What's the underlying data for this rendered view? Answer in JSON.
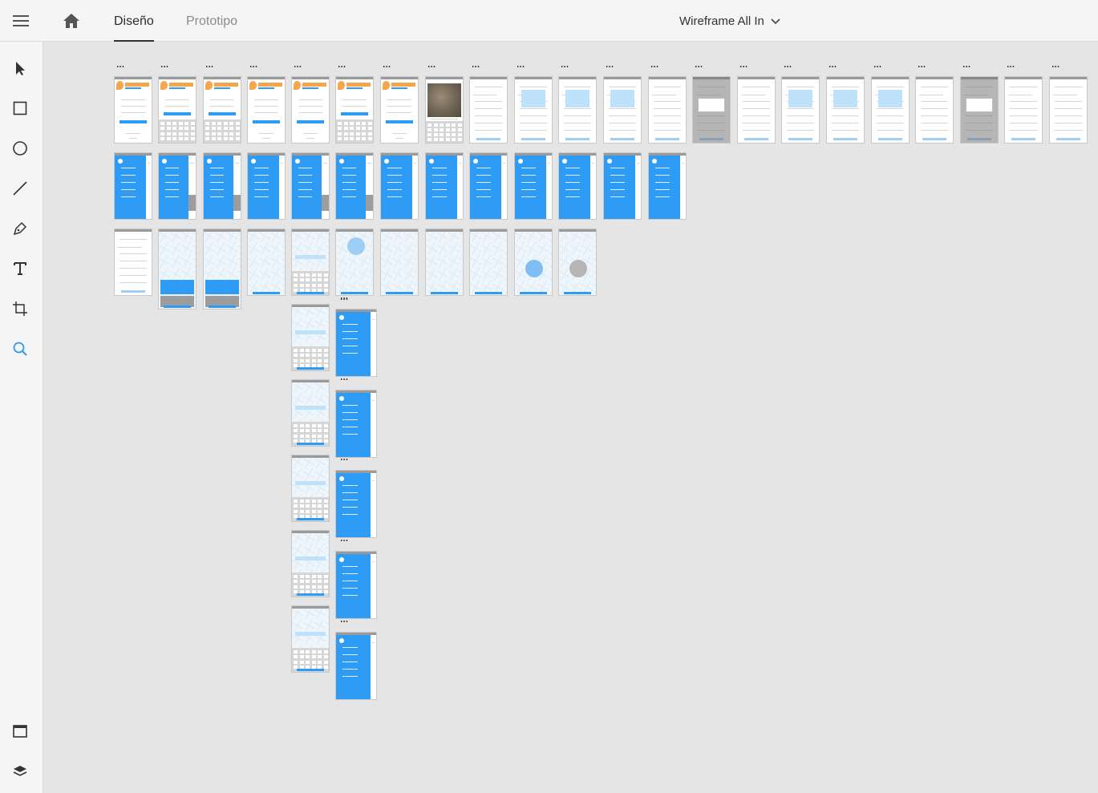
{
  "header": {
    "menu_icon": "hamburger-menu-icon",
    "home_icon": "home-icon",
    "tabs": [
      {
        "label": "Diseño",
        "active": true
      },
      {
        "label": "Prototipo",
        "active": false
      }
    ],
    "document_title": "Wireframe All In",
    "dropdown_icon": "chevron-down-icon"
  },
  "toolbar": {
    "tools": [
      {
        "name": "select-tool",
        "icon": "arrow-cursor-icon"
      },
      {
        "name": "rectangle-tool",
        "icon": "rectangle-icon"
      },
      {
        "name": "ellipse-tool",
        "icon": "ellipse-icon"
      },
      {
        "name": "line-tool",
        "icon": "line-icon"
      },
      {
        "name": "pen-tool",
        "icon": "pen-icon"
      },
      {
        "name": "text-tool",
        "icon": "text-icon"
      },
      {
        "name": "artboard-tool",
        "icon": "artboard-icon"
      },
      {
        "name": "zoom-tool",
        "icon": "zoom-icon",
        "active": true
      }
    ],
    "bottom": [
      {
        "name": "assets-panel",
        "icon": "assets-icon"
      },
      {
        "name": "layers-panel",
        "icon": "layers-icon"
      }
    ]
  },
  "colors": {
    "accent": "#2e9bf5",
    "light_accent": "#bfe2fb",
    "logo_orange": "#f5a54a",
    "canvas": "#e5e5e5",
    "panel": "#f5f5f5"
  },
  "canvas": {
    "artboard_rows": [
      {
        "row": 1,
        "count": 21,
        "kind": "login / onboarding / list screens"
      },
      {
        "row": 2,
        "count": 13,
        "kind": "side menu screens"
      },
      {
        "row": 3,
        "count": 11,
        "kind": "map screens"
      },
      {
        "column": "search keyboard screens",
        "count": 4
      },
      {
        "column": "side menu overlay screens",
        "count": 5
      }
    ]
  }
}
